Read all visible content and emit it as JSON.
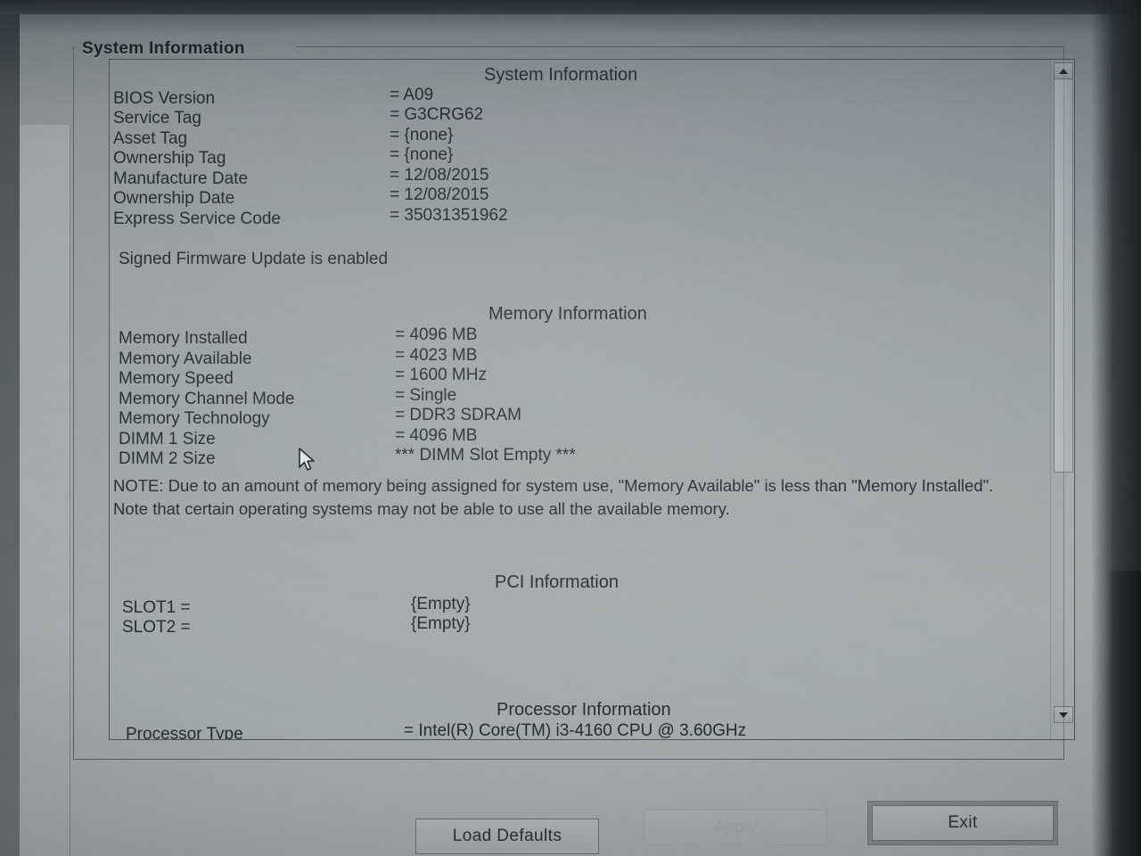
{
  "window": {
    "group_title": "System Information"
  },
  "sections": {
    "system": {
      "heading": "System Information",
      "rows": [
        {
          "label": "BIOS Version",
          "value": "= A09"
        },
        {
          "label": "Service Tag",
          "value": "= G3CRG62"
        },
        {
          "label": "Asset Tag",
          "value": "= {none}"
        },
        {
          "label": "Ownership Tag",
          "value": "= {none}"
        },
        {
          "label": "Manufacture Date",
          "value": "= 12/08/2015"
        },
        {
          "label": "Ownership Date",
          "value": "= 12/08/2015"
        },
        {
          "label": "Express Service Code",
          "value": "= 35031351962"
        }
      ],
      "status": "Signed Firmware Update is enabled"
    },
    "memory": {
      "heading": "Memory Information",
      "rows": [
        {
          "label": "Memory Installed",
          "value": "= 4096 MB"
        },
        {
          "label": "Memory Available",
          "value": "= 4023 MB"
        },
        {
          "label": "Memory Speed",
          "value": "= 1600 MHz"
        },
        {
          "label": "Memory Channel Mode",
          "value": "= Single"
        },
        {
          "label": "Memory Technology",
          "value": "= DDR3 SDRAM"
        },
        {
          "label": "DIMM 1 Size",
          "value": "= 4096 MB"
        },
        {
          "label": "DIMM 2 Size",
          "value": "*** DIMM Slot Empty ***"
        }
      ],
      "note": "NOTE: Due to an amount of memory being assigned for system use, \"Memory Available\" is less than \"Memory Installed\". Note that certain operating systems may not be able to use all the available memory."
    },
    "pci": {
      "heading": "PCI Information",
      "rows": [
        {
          "label": "SLOT1 =",
          "value": "{Empty}"
        },
        {
          "label": "SLOT2 =",
          "value": "{Empty}"
        }
      ]
    },
    "processor": {
      "heading": "Processor Information",
      "rows": [
        {
          "label": "Processor Type",
          "value": "= Intel(R) Core(TM) i3-4160 CPU @ 3.60GHz"
        }
      ]
    }
  },
  "scrollbar": {
    "up_icon": "scroll-up-arrow-icon",
    "down_icon": "scroll-down-arrow-icon"
  },
  "footer": {
    "load_defaults": "Load Defaults",
    "apply": "Apply",
    "exit": "Exit"
  },
  "colors": {
    "screen_bg": "#9aa0a3",
    "text": "#232a2f",
    "border": "#5f666b"
  }
}
